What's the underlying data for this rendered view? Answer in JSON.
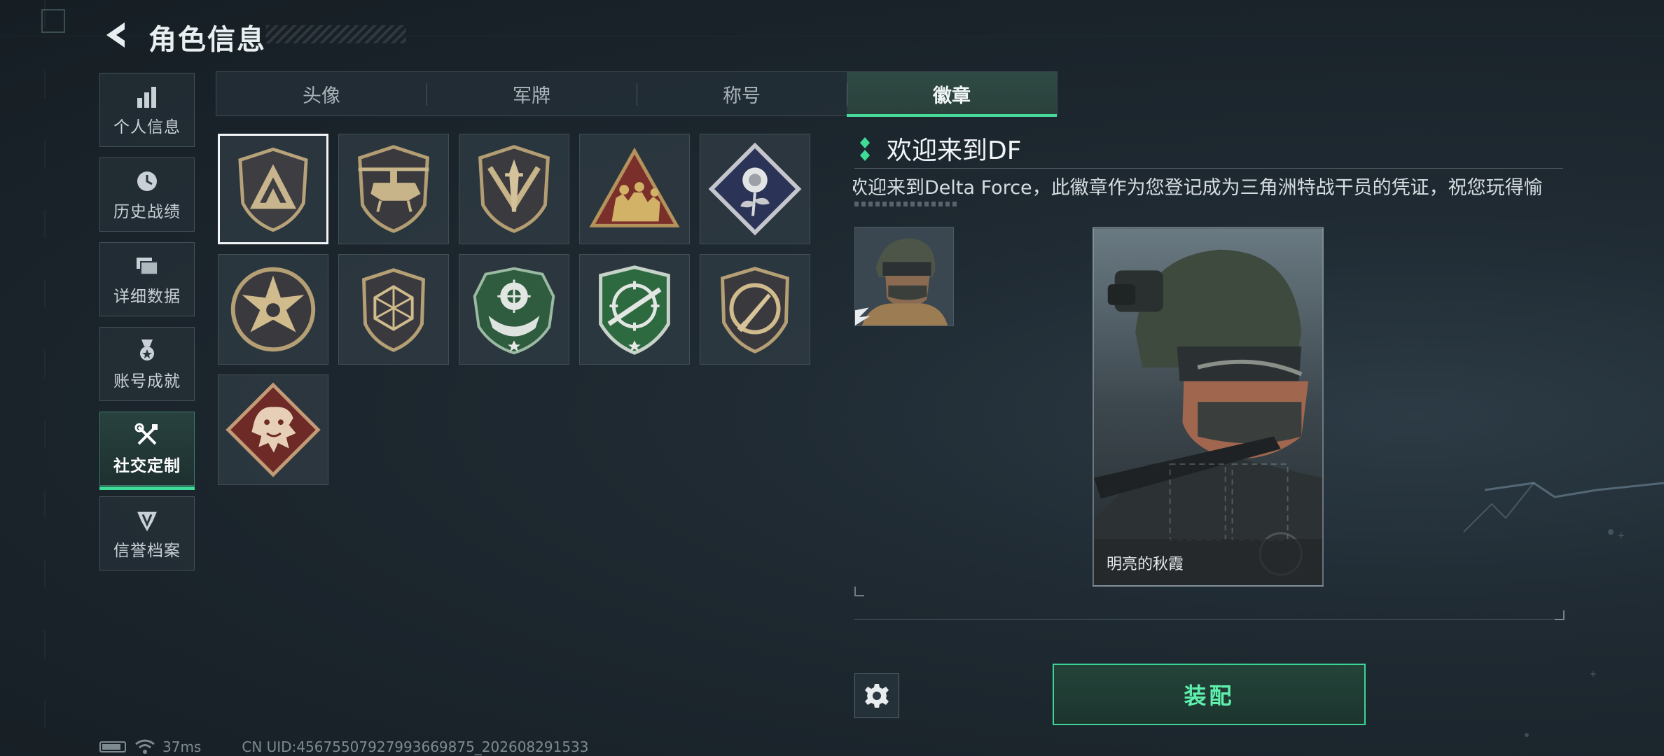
{
  "header": {
    "title": "角色信息",
    "back_icon": "chevron-left-icon"
  },
  "sidebar": {
    "items": [
      {
        "label": "个人信息",
        "icon": "bar-chart-icon",
        "active": false
      },
      {
        "label": "历史战绩",
        "icon": "history-icon",
        "active": false
      },
      {
        "label": "详细数据",
        "icon": "folders-icon",
        "active": false
      },
      {
        "label": "账号成就",
        "icon": "medal-icon",
        "active": false
      },
      {
        "label": "社交定制",
        "icon": "wrench-icon",
        "active": true
      },
      {
        "label": "信誉档案",
        "icon": "emblem-icon",
        "active": false
      }
    ]
  },
  "tabs": {
    "items": [
      {
        "label": "头像",
        "active": false
      },
      {
        "label": "军牌",
        "active": false
      },
      {
        "label": "称号",
        "active": false
      },
      {
        "label": "徽章",
        "active": true
      }
    ]
  },
  "badges": [
    {
      "name": "triangle-shield-badge-icon",
      "selected": true
    },
    {
      "name": "helicopter-badge-icon",
      "selected": false
    },
    {
      "name": "dagger-shield-badge-icon",
      "selected": false
    },
    {
      "name": "soldiers-triangle-badge-icon",
      "selected": false
    },
    {
      "name": "rose-diamond-badge-icon",
      "selected": false
    },
    {
      "name": "star-circle-badge-icon",
      "selected": false
    },
    {
      "name": "geometric-shield-badge-icon",
      "selected": false
    },
    {
      "name": "crosshair-green-badge-icon",
      "selected": false
    },
    {
      "name": "rifle-green-badge-icon",
      "selected": false
    },
    {
      "name": "knife-circle-badge-icon",
      "selected": false
    },
    {
      "name": "dragon-diamond-badge-icon",
      "selected": false
    }
  ],
  "detail": {
    "title": "欢迎来到DF",
    "description": "欢迎来到Delta Force，此徽章作为您登记成为三角洲特战干员的凭证，祝您玩得愉",
    "card_name": "明亮的秋霞"
  },
  "actions": {
    "equip_label": "装配",
    "settings_icon": "gear-icon"
  },
  "status": {
    "ping": "37ms",
    "uid": "CN UID:4567550792799366987​5_202608291533"
  },
  "colors": {
    "accent": "#3ddc97",
    "background": "#1c262d"
  }
}
